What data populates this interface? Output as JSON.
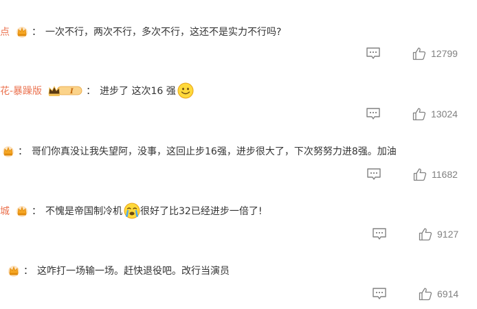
{
  "comments": [
    {
      "name": "点",
      "badge": "crown-badge",
      "colon": "：",
      "text": "一次不行，两次不行，多次不行，这还不是实力不行吗?",
      "likes": "12799"
    },
    {
      "name": "花-暴躁版",
      "badge": "vip-level-badge",
      "badge_text": "I",
      "colon": "：",
      "text": "进步了 这次16 强",
      "emoji": "smile-emoji",
      "likes": "13024"
    },
    {
      "name": "",
      "badge": "crown-badge",
      "colon": "：",
      "text": "哥们你真没让我失望阿，没事，这回止步16强，进步很大了，下次努努力进8强。加油",
      "likes": "11682"
    },
    {
      "name": "城",
      "badge": "crown-badge",
      "colon": "：",
      "text_before": "不愧是帝国制冷机",
      "emoji": "tears-emoji",
      "text_after": "很好了比32已经进步一倍了!",
      "likes": "9127"
    },
    {
      "name": "",
      "badge": "crown-badge",
      "colon": "：",
      "text": "这咋打一场输一场。赶快退役吧。改行当演员",
      "likes": "6914"
    }
  ],
  "colors": {
    "name": "#eb7350",
    "text": "#333333",
    "icon": "#808080",
    "crown": "#f5a623"
  }
}
